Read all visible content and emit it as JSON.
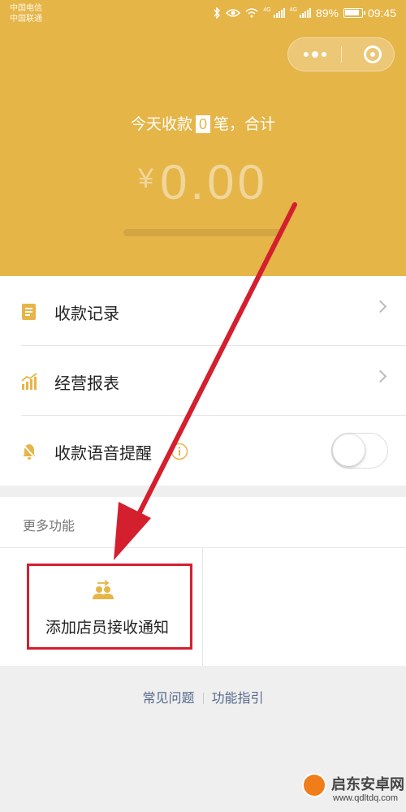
{
  "status_bar": {
    "carrier_1": "中国电信",
    "carrier_2": "中国联通",
    "net_1": "4G",
    "net_2": "4G",
    "battery": "89%",
    "time": "09:45"
  },
  "capsule": {
    "more_icon": "more-dots-icon",
    "close_icon": "target-close-icon"
  },
  "summary": {
    "prefix": "今天收款",
    "count": "0",
    "suffix": "笔，合计",
    "currency": "¥",
    "amount": "0.00"
  },
  "menu": {
    "records": "收款记录",
    "report": "经营报表",
    "voice": "收款语音提醒",
    "voice_enabled": false
  },
  "more": {
    "title": "更多功能",
    "add_staff": "添加店员接收通知"
  },
  "footer": {
    "faq": "常见问题",
    "guide": "功能指引"
  },
  "watermark": {
    "name": "启东安卓网",
    "url": "www.qdltdq.com"
  },
  "colors": {
    "header": "#e5b548",
    "annotation": "#d41f2e",
    "link": "#57698c"
  }
}
